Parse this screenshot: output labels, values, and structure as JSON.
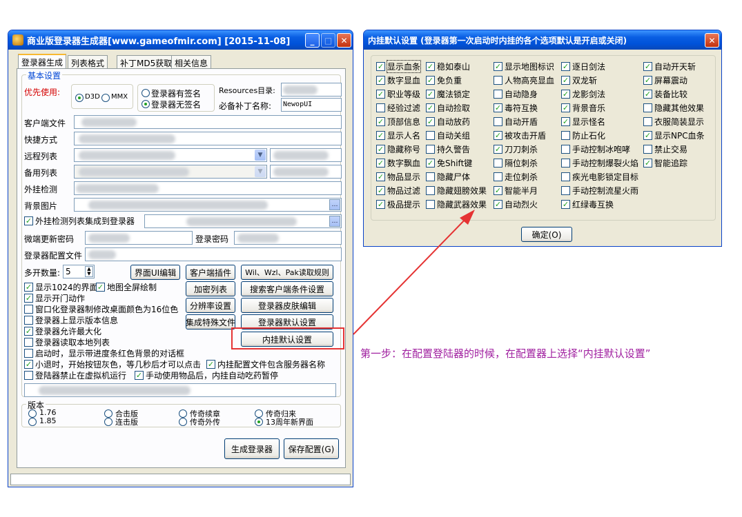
{
  "main": {
    "title": "商业版登录器生成器[www.gameofmir.com] [2015-11-08]",
    "tabs": [
      "登录器生成",
      "列表格式",
      "补丁MD5获取",
      "相关信息"
    ],
    "basic_group": "基本设置",
    "priority_label": "优先使用:",
    "radio_d3d": "D3D",
    "radio_mmx": "MMX",
    "sign_has": "登录器有签名",
    "sign_none": "登录器无签名",
    "resources_label": "Resources目录:",
    "patch_label": "必备补丁名称:",
    "patch_value": "NewopUI",
    "client_file": "客户端文件",
    "shortcut": "快捷方式",
    "remote_list": "远程列表",
    "backup_list": "备用列表",
    "plugin_check": "外挂检测",
    "bg_image": "背景图片",
    "plugin_list_cb": "外挂检测列表集成到登录器",
    "micro_update_pw": "微端更新密码",
    "login_pw": "登录密码",
    "config_file": "登录器配置文件",
    "multi_label": "多开数量:",
    "multi_value": "5",
    "buttons": {
      "ui_edit": "界面UI编辑",
      "client_plugin": "客户端插件",
      "wil_rule": "Wil、Wzl、Pak读取规则",
      "encrypt_list": "加密列表",
      "search_client": "搜索客户端条件设置",
      "resolution": "分辨率设置",
      "skin_edit": "登录器皮肤编辑",
      "special_file": "集成特殊文件",
      "default_set": "登录器默认设置",
      "plugin_default": "内挂默认设置",
      "generate": "生成登录器",
      "save_config": "保存配置(G)"
    },
    "options": [
      "显示1024的界面",
      "地图全屏绘制",
      "显示开门动作",
      "窗口化登录器制修改桌面颜色为16位色",
      "登录器上显示版本信息",
      "登录器允许最大化",
      "登录器读取本地列表",
      "启动时，显示带进度条红色背景的对话框",
      "小退时，开始按钮灰色，等几秒后才可以点击",
      "内挂配置文件包含服务器名称",
      "登陆器禁止在虚拟机运行",
      "手动使用物品后，内挂自动吃药暂停"
    ],
    "version_group": "版本",
    "versions": [
      "1.76",
      "1.85",
      "合击版",
      "连击版",
      "传奇续章",
      "传奇外传",
      "传奇归来",
      "13周年新界面"
    ]
  },
  "dialog": {
    "title": "内挂默认设置 (登录器第一次启动时内挂的各个选项默认是开启或关闭)",
    "ok": "确定(O)",
    "columns": [
      [
        [
          "显示血条",
          true
        ],
        [
          "数字显血",
          true
        ],
        [
          "职业等级",
          true
        ],
        [
          "经验过滤",
          false
        ],
        [
          "顶部信息",
          true
        ],
        [
          "显示人名",
          true
        ],
        [
          "隐藏称号",
          true
        ],
        [
          "数字飘血",
          true
        ],
        [
          "物品显示",
          true
        ],
        [
          "物品过滤",
          true
        ],
        [
          "极品提示",
          true
        ]
      ],
      [
        [
          "稳如泰山",
          true
        ],
        [
          "免负重",
          true
        ],
        [
          "魔法锁定",
          true
        ],
        [
          "自动捡取",
          true
        ],
        [
          "自动放药",
          true
        ],
        [
          "自动关组",
          false
        ],
        [
          "持久警告",
          false
        ],
        [
          "免Shift键",
          true
        ],
        [
          "隐藏尸体",
          false
        ],
        [
          "隐藏翅膀效果",
          false
        ],
        [
          "隐藏武器效果",
          false
        ]
      ],
      [
        [
          "显示地图标识",
          true
        ],
        [
          "人物高亮显血",
          false
        ],
        [
          "自动隐身",
          false
        ],
        [
          "毒符互换",
          true
        ],
        [
          "自动开盾",
          false
        ],
        [
          "被攻击开盾",
          true
        ],
        [
          "刀刀刺杀",
          true
        ],
        [
          "隔位刺杀",
          false
        ],
        [
          "走位刺杀",
          false
        ],
        [
          "智能半月",
          true
        ],
        [
          "自动烈火",
          true
        ]
      ],
      [
        [
          "逐日剑法",
          true
        ],
        [
          "双龙斩",
          true
        ],
        [
          "龙影剑法",
          true
        ],
        [
          "背景音乐",
          true
        ],
        [
          "显示怪名",
          true
        ],
        [
          "防止石化",
          false
        ],
        [
          "手动控制冰咆哮",
          false
        ],
        [
          "手动控制爆裂火焰",
          false
        ],
        [
          "疾光电影锁定目标",
          false
        ],
        [
          "手动控制流星火雨",
          false
        ],
        [
          "红绿毒互换",
          true
        ]
      ],
      [
        [
          "自动开天斩",
          true
        ],
        [
          "屏幕震动",
          true
        ],
        [
          "装备比较",
          true
        ],
        [
          "隐藏其他效果",
          false
        ],
        [
          "衣服简装显示",
          false
        ],
        [
          "显示NPC血条",
          true
        ],
        [
          "禁止交易",
          false
        ],
        [
          "智能追踪",
          true
        ]
      ]
    ]
  },
  "annotation": "第一步：在配置登陆器的时候，在配置器上选择“内挂默认设置”",
  "colors": {
    "annotation": "#a020a0",
    "highlight": "#e53333"
  }
}
